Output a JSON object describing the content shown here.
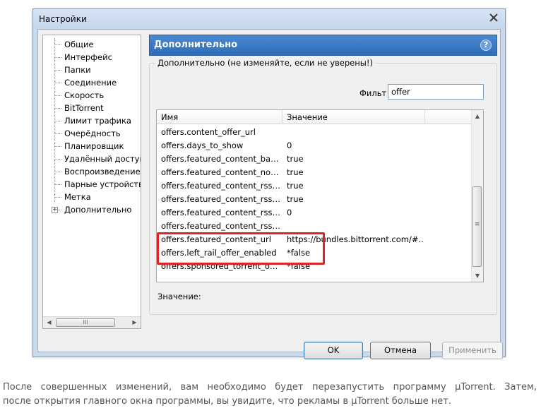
{
  "window": {
    "title": "Настройки",
    "close_icon": "close-icon"
  },
  "sidebar": {
    "items": [
      {
        "label": "Общие"
      },
      {
        "label": "Интерфейс"
      },
      {
        "label": "Папки"
      },
      {
        "label": "Соединение"
      },
      {
        "label": "Скорость"
      },
      {
        "label": "BitTorrent"
      },
      {
        "label": "Лимит трафика"
      },
      {
        "label": "Очерёдность"
      },
      {
        "label": "Планировщик"
      },
      {
        "label": "Удалённый доступ"
      },
      {
        "label": "Воспроизведение"
      },
      {
        "label": "Парные устройства"
      },
      {
        "label": "Метка"
      },
      {
        "label": "Дополнительно",
        "expander": "+"
      }
    ],
    "scroll_grip": "III"
  },
  "panel": {
    "title": "Дополнительно",
    "help": "?",
    "group_legend": "Дополнительно (не изменяйте, если не уверены!)",
    "filter_label": "Фильт",
    "filter_value": "offer",
    "columns": {
      "name": "Имя",
      "value": "Значение"
    },
    "rows": [
      {
        "name": "offers.content_offer_url",
        "value": ""
      },
      {
        "name": "offers.days_to_show",
        "value": "0"
      },
      {
        "name": "offers.featured_content_badge...",
        "value": "true"
      },
      {
        "name": "offers.featured_content_notific...",
        "value": "true"
      },
      {
        "name": "offers.featured_content_rss_en...",
        "value": "true"
      },
      {
        "name": "offers.featured_content_rss_ra...",
        "value": "true"
      },
      {
        "name": "offers.featured_content_rss_up...",
        "value": "0"
      },
      {
        "name": "offers.featured_content_rss_url",
        "value": ""
      },
      {
        "name": "offers.featured_content_url",
        "value": "https://bundles.bittorrent.com/#..."
      },
      {
        "name": "offers.left_rail_offer_enabled",
        "value": "*false"
      },
      {
        "name": "offers.sponsored_torrent_offer...",
        "value": "*false"
      }
    ],
    "value_label": "Значение:",
    "scroll_grip": "≡",
    "highlight_color": "#e02424"
  },
  "buttons": {
    "ok": "OK",
    "cancel": "Отмена",
    "apply": "Применить"
  },
  "caption": {
    "line1": "После совершенных изменений, вам необходимо будет перезапустить программу µTorrent. Затем,",
    "line2": "после открытия главного окна программы, вы увидите, что рекламы в µTorrent больше нет."
  }
}
